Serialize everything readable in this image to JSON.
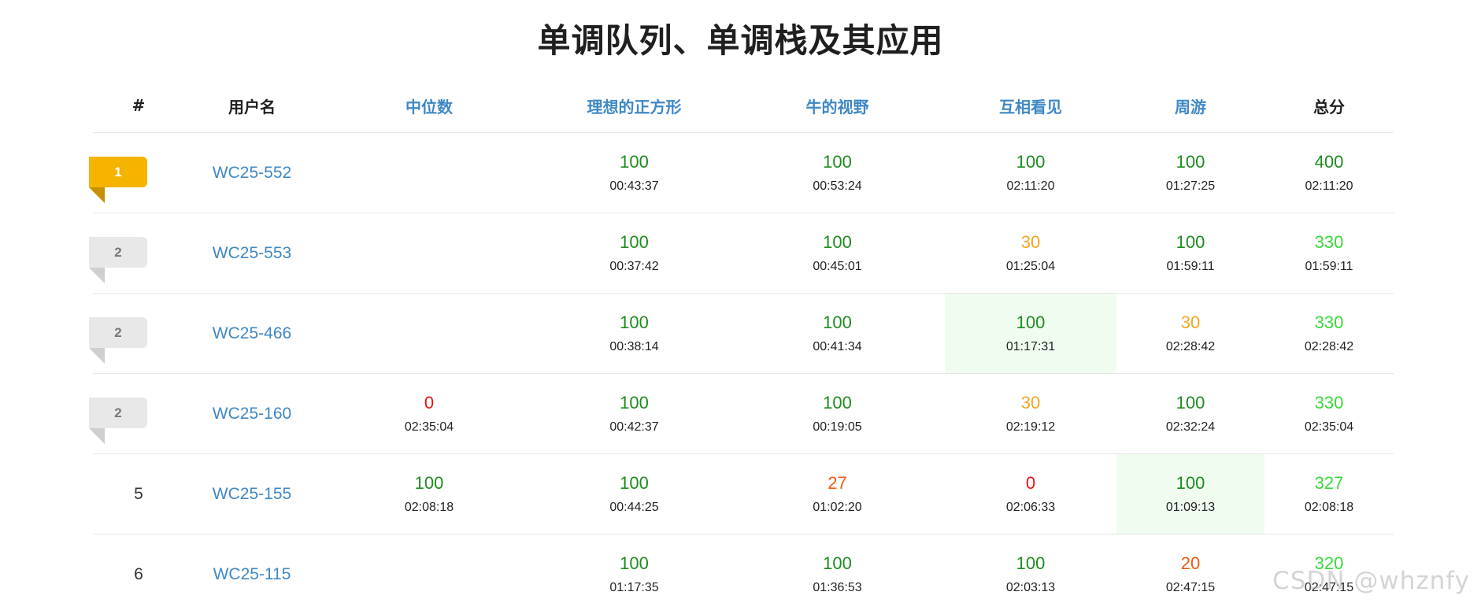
{
  "page_title": "单调队列、单调栈及其应用",
  "headers": {
    "rank": "#",
    "user": "用户名",
    "problems": [
      "中位数",
      "理想的正方形",
      "牛的视野",
      "互相看见",
      "周游"
    ],
    "total": "总分"
  },
  "colors": {
    "full": "#1e8c1e",
    "partial_yellow": "#f5a623",
    "partial_orange": "#ee5a11",
    "zero": "#ee1111",
    "total_light": "#39d939",
    "total_dark": "#1e8c1e",
    "link": "#3f88c5",
    "first_blood_bg": "#f1fcf0"
  },
  "rows": [
    {
      "rank": "1",
      "rank_style": "gold",
      "user": "WC25-552",
      "cells": [
        {
          "score": "",
          "time": ""
        },
        {
          "score": "100",
          "time": "00:43:37",
          "color": "#1e8c1e"
        },
        {
          "score": "100",
          "time": "00:53:24",
          "color": "#1e8c1e"
        },
        {
          "score": "100",
          "time": "02:11:20",
          "color": "#1e8c1e"
        },
        {
          "score": "100",
          "time": "01:27:25",
          "color": "#1e8c1e"
        }
      ],
      "total": "400",
      "total_time": "02:11:20",
      "total_color": "#1e8c1e"
    },
    {
      "rank": "2",
      "rank_style": "silver",
      "user": "WC25-553",
      "cells": [
        {
          "score": "",
          "time": ""
        },
        {
          "score": "100",
          "time": "00:37:42",
          "color": "#1e8c1e"
        },
        {
          "score": "100",
          "time": "00:45:01",
          "color": "#1e8c1e"
        },
        {
          "score": "30",
          "time": "01:25:04",
          "color": "#f5a623"
        },
        {
          "score": "100",
          "time": "01:59:11",
          "color": "#1e8c1e"
        }
      ],
      "total": "330",
      "total_time": "01:59:11",
      "total_color": "#39d939"
    },
    {
      "rank": "2",
      "rank_style": "silver",
      "user": "WC25-466",
      "cells": [
        {
          "score": "",
          "time": ""
        },
        {
          "score": "100",
          "time": "00:38:14",
          "color": "#1e8c1e"
        },
        {
          "score": "100",
          "time": "00:41:34",
          "color": "#1e8c1e"
        },
        {
          "score": "100",
          "time": "01:17:31",
          "color": "#1e8c1e",
          "highlight": true
        },
        {
          "score": "30",
          "time": "02:28:42",
          "color": "#f5a623"
        }
      ],
      "total": "330",
      "total_time": "02:28:42",
      "total_color": "#39d939"
    },
    {
      "rank": "2",
      "rank_style": "silver",
      "user": "WC25-160",
      "cells": [
        {
          "score": "0",
          "time": "02:35:04",
          "color": "#ee1111"
        },
        {
          "score": "100",
          "time": "00:42:37",
          "color": "#1e8c1e"
        },
        {
          "score": "100",
          "time": "00:19:05",
          "color": "#1e8c1e"
        },
        {
          "score": "30",
          "time": "02:19:12",
          "color": "#f5a623"
        },
        {
          "score": "100",
          "time": "02:32:24",
          "color": "#1e8c1e"
        }
      ],
      "total": "330",
      "total_time": "02:35:04",
      "total_color": "#39d939"
    },
    {
      "rank": "5",
      "rank_style": "plain",
      "user": "WC25-155",
      "cells": [
        {
          "score": "100",
          "time": "02:08:18",
          "color": "#1e8c1e"
        },
        {
          "score": "100",
          "time": "00:44:25",
          "color": "#1e8c1e"
        },
        {
          "score": "27",
          "time": "01:02:20",
          "color": "#ee5a11"
        },
        {
          "score": "0",
          "time": "02:06:33",
          "color": "#ee1111"
        },
        {
          "score": "100",
          "time": "01:09:13",
          "color": "#1e8c1e",
          "highlight": true
        }
      ],
      "total": "327",
      "total_time": "02:08:18",
      "total_color": "#39d939"
    },
    {
      "rank": "6",
      "rank_style": "plain",
      "user": "WC25-115",
      "cells": [
        {
          "score": "",
          "time": ""
        },
        {
          "score": "100",
          "time": "01:17:35",
          "color": "#1e8c1e"
        },
        {
          "score": "100",
          "time": "01:36:53",
          "color": "#1e8c1e"
        },
        {
          "score": "100",
          "time": "02:03:13",
          "color": "#1e8c1e"
        },
        {
          "score": "20",
          "time": "02:47:15",
          "color": "#ee5a11"
        }
      ],
      "total": "320",
      "total_time": "02:47:15",
      "total_color": "#39d939"
    }
  ],
  "watermark": "CSDN @whznfy"
}
